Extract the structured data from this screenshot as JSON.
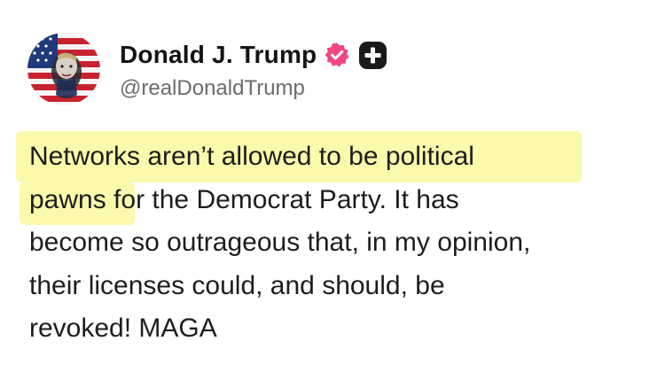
{
  "author": {
    "display_name": "Donald J. Trump",
    "handle": "@realDonaldTrump",
    "avatar_icon": "flag-portrait-avatar",
    "badges": [
      "verified-badge-icon",
      "plus-badge-icon"
    ]
  },
  "post": {
    "lines": [
      "Networks aren’t allowed to be political",
      "pawns for the Democrat Party. It has",
      "become so outrageous that, in my opinion,",
      "their licenses could, and should, be",
      "revoked! MAGA"
    ],
    "highlighted_text": "Networks aren’t allowed to be political pawns"
  },
  "colors": {
    "verified_badge": "#f2467e",
    "highlight": "#fbf9a6",
    "handle_text": "#6b6b6b",
    "body_text": "#1d1d1d"
  }
}
